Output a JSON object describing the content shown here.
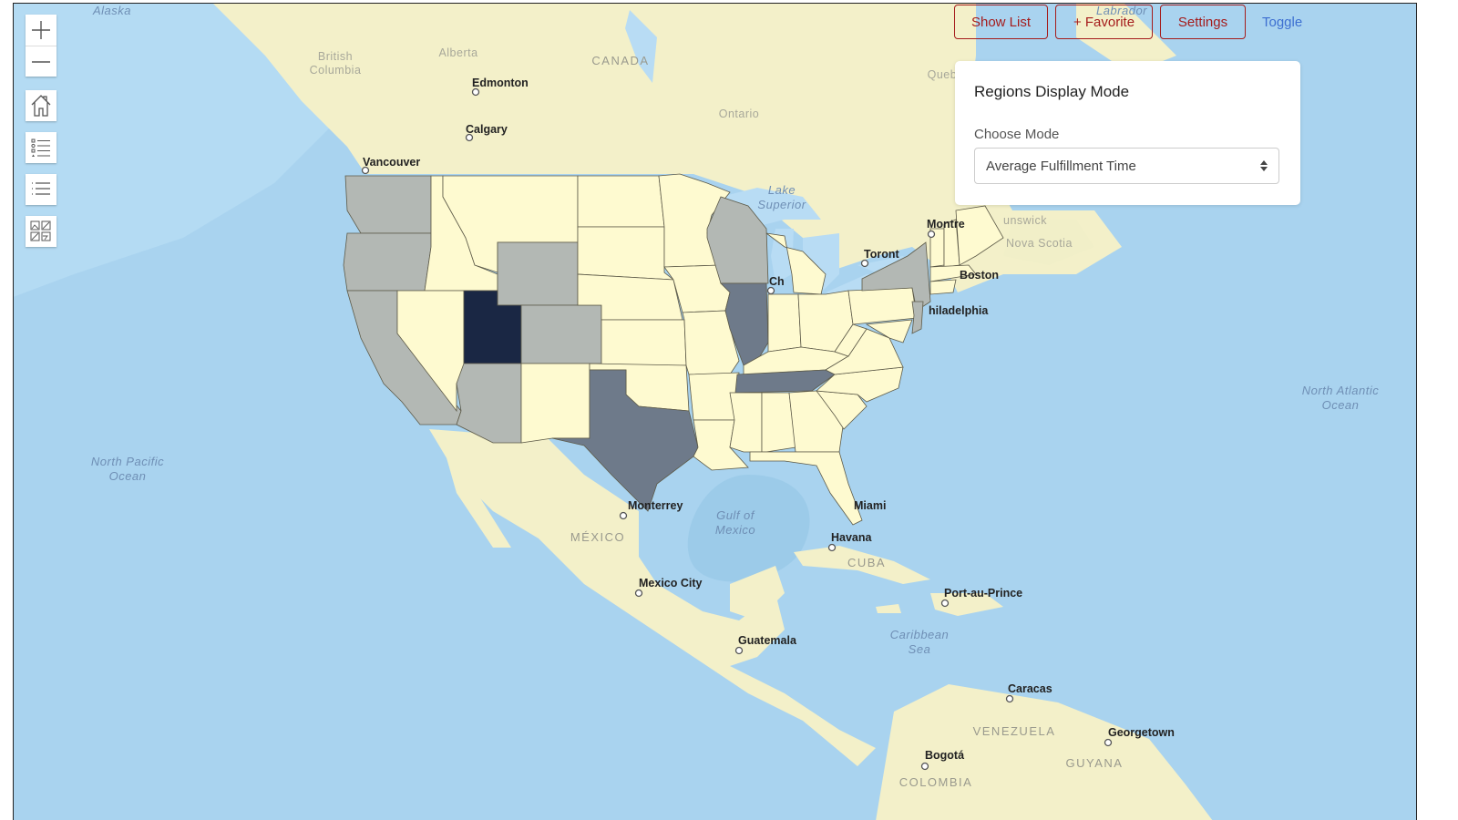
{
  "toolbar": {
    "show_list_label": "Show List",
    "favorite_label": "+ Favorite",
    "settings_label": "Settings",
    "toggle_label": "Toggle"
  },
  "map_controls": {
    "zoom_in": "zoom-in-icon",
    "zoom_out": "zoom-out-icon",
    "home": "home-icon",
    "legend": "legend-icon",
    "layer_list": "list-icon",
    "basemap_gallery": "basemap-gallery-icon"
  },
  "panel": {
    "title": "Regions Display Mode",
    "label": "Choose Mode",
    "selected_mode": "Average Fulfillment Time"
  },
  "choropleth": {
    "mode": "Average Fulfillment Time",
    "colors": {
      "none": "#fefad0",
      "low": "#b3b8b4",
      "medium": "#6e7a8a",
      "high": "#1a2744"
    },
    "states": {
      "Washington": "low",
      "Oregon": "low",
      "California": "low",
      "Arizona": "low",
      "Wyoming": "low",
      "Colorado": "low",
      "Wisconsin": "low",
      "New York": "low",
      "New Jersey": "low",
      "Utah": "high",
      "Texas": "medium",
      "Illinois": "medium",
      "Tennessee": "medium"
    }
  },
  "map_labels": {
    "cities": [
      "Edmonton",
      "Calgary",
      "Vancouver",
      "Toront",
      "Montre",
      "Boston",
      "hiladelphia",
      "Ch",
      "Miami",
      "Havana",
      "Monterrey",
      "Mexico City",
      "Guatemala",
      "Port-au-Prince",
      "Caracas",
      "Georgetown",
      "Bogotá"
    ],
    "regions": [
      "Alaska",
      "British Columbia",
      "Alberta",
      "Ontario",
      "Quebec",
      "New Brunswick",
      "Nova Scotia",
      "Labrador Sea"
    ],
    "countries": [
      "CANADA",
      "MÉXICO",
      "CUBA",
      "VENEZUELA",
      "GUYANA",
      "COLOMBIA"
    ],
    "water": [
      "North Pacific Ocean",
      "North Atlantic Ocean",
      "Gulf of Mexico",
      "Caribbean Sea",
      "Lake Superior"
    ]
  }
}
